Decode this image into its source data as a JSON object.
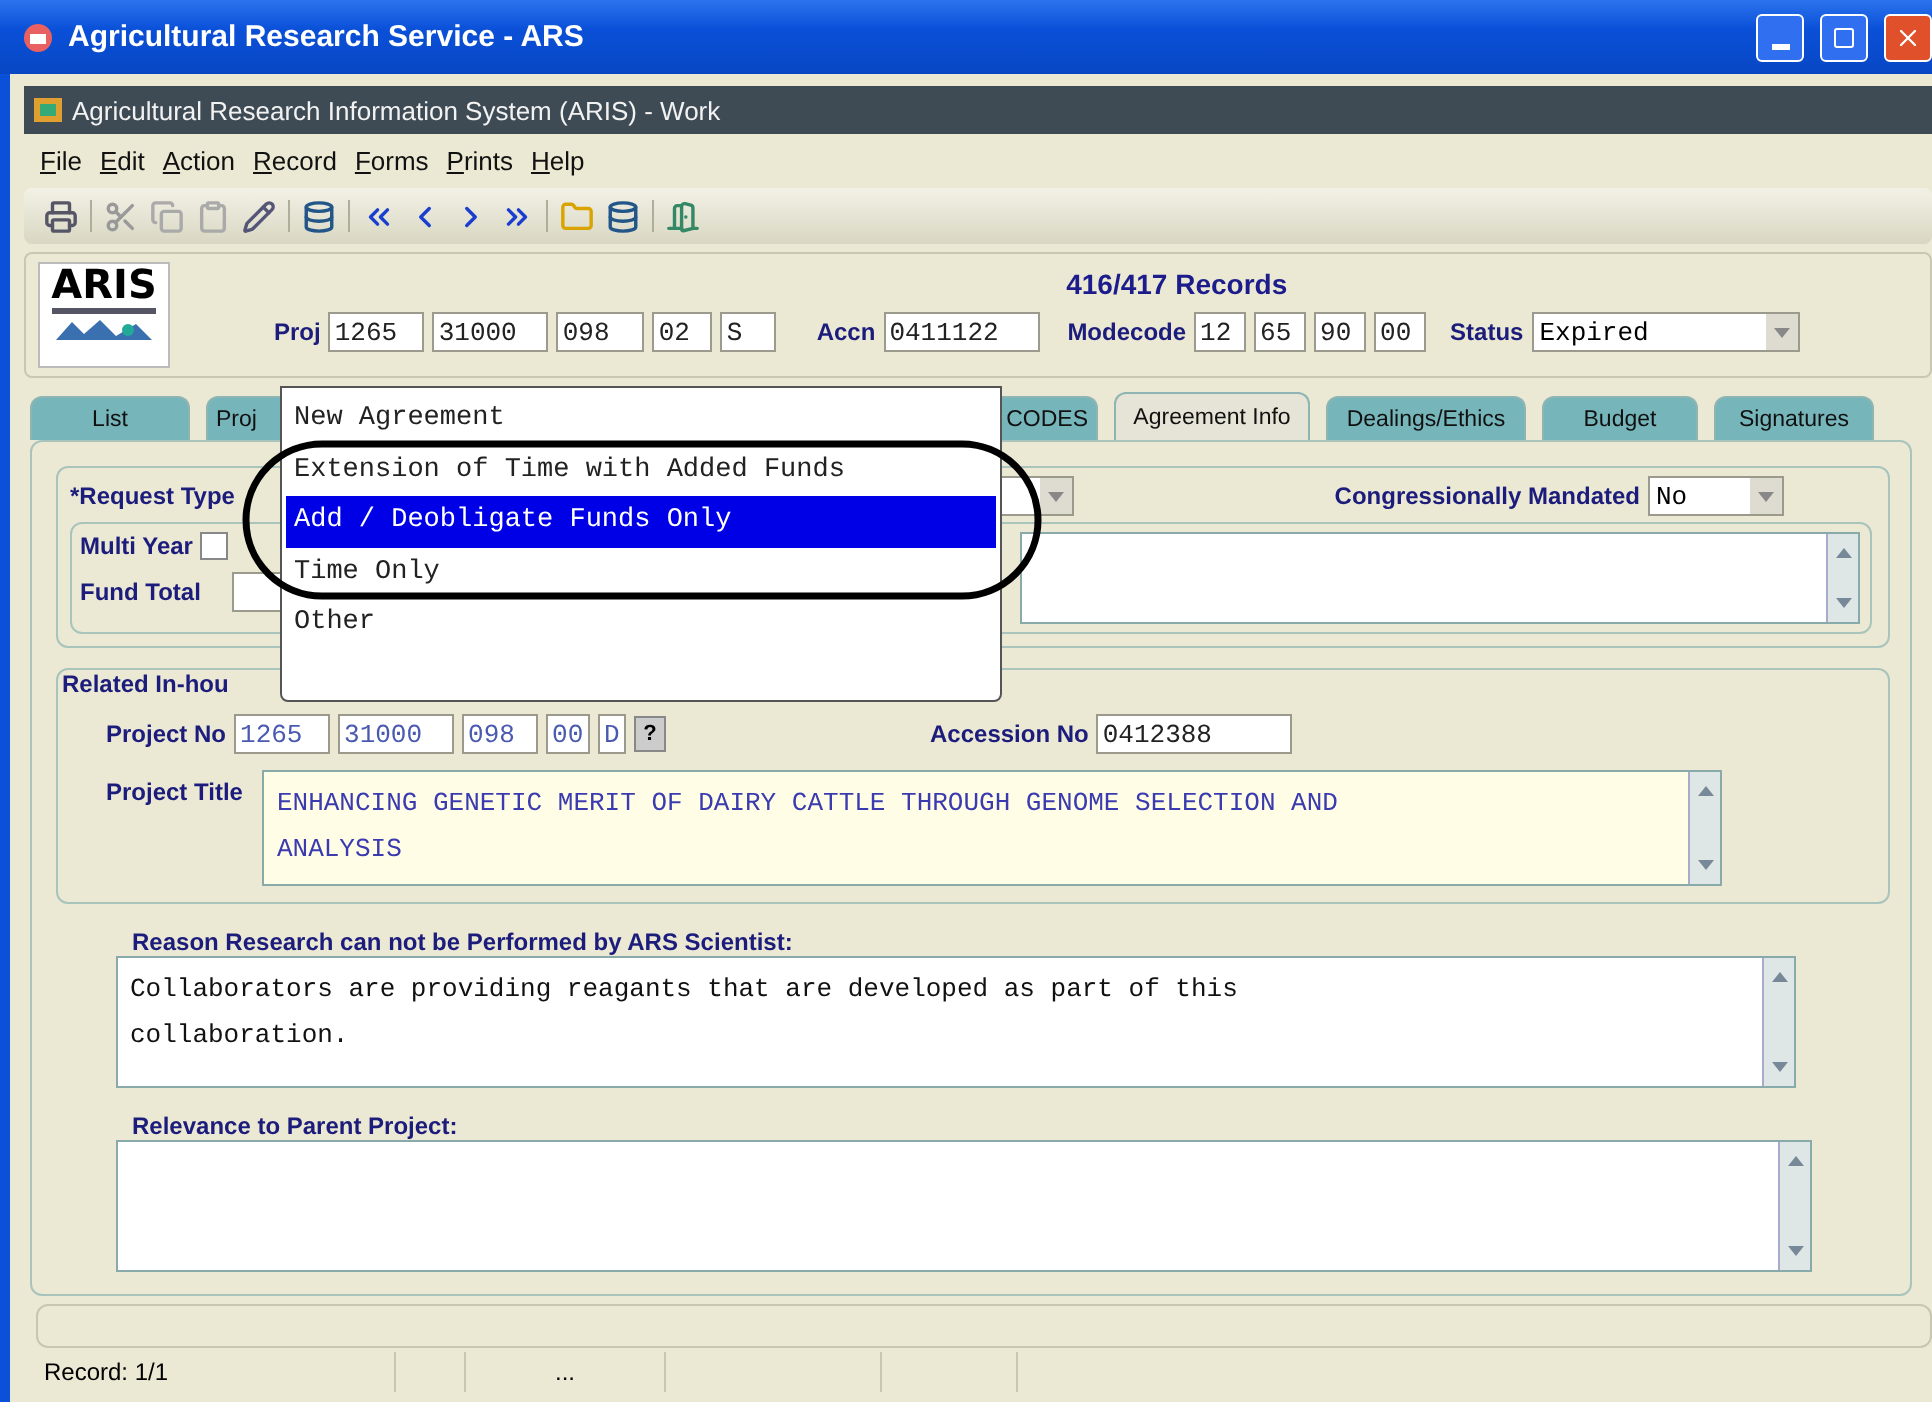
{
  "window": {
    "title": "Agricultural Research Service - ARS"
  },
  "app_title": "Agricultural Research Information System (ARIS) - Work",
  "menu": [
    "File",
    "Edit",
    "Action",
    "Record",
    "Forms",
    "Prints",
    "Help"
  ],
  "header": {
    "logo": "ARIS",
    "records": "416/417 Records",
    "proj_label": "Proj",
    "proj": [
      "1265",
      "31000",
      "098",
      "02",
      "S"
    ],
    "accn_label": "Accn",
    "accn": "0411122",
    "modecode_label": "Modecode",
    "modecode": [
      "12",
      "65",
      "90",
      "00"
    ],
    "status_label": "Status",
    "status": "Expired"
  },
  "tabs": [
    {
      "label": "List",
      "selected": false
    },
    {
      "label": "Proj",
      "selected": false
    },
    {
      "label": "CODES",
      "selected": false
    },
    {
      "label": "Agreement Info",
      "selected": true
    },
    {
      "label": "Dealings/Ethics",
      "selected": false
    },
    {
      "label": "Budget",
      "selected": false
    },
    {
      "label": "Signatures",
      "selected": false
    }
  ],
  "request": {
    "type_label": "*Request Type",
    "mandated_label": "Congressionally Mandated",
    "mandated": "No",
    "multi_year_label": "Multi Year",
    "multi_year_checked": false,
    "fund_total_label": "Fund Total"
  },
  "related": {
    "legend": "Related In-hou",
    "project_no_label": "Project No",
    "project_no": [
      "1265",
      "31000",
      "098",
      "00",
      "D"
    ],
    "help": "?",
    "accession_label": "Accession No",
    "accession": "0412388",
    "title_label": "Project Title",
    "title": "ENHANCING GENETIC MERIT OF DAIRY CATTLE THROUGH GENOME SELECTION AND ANALYSIS"
  },
  "reason": {
    "label": "Reason Research can not be Performed by ARS Scientist:",
    "value": "Collaborators are providing reagants that are developed as part of this collaboration."
  },
  "relevance": {
    "label": "Relevance to Parent Project:"
  },
  "dropdown": {
    "options": [
      {
        "label": "New Agreement",
        "selected": false
      },
      {
        "label": "Extension of Time with Added Funds",
        "selected": false
      },
      {
        "label": "Add / Deobligate Funds Only",
        "selected": true
      },
      {
        "label": "Time Only",
        "selected": false
      },
      {
        "label": "Other",
        "selected": false
      }
    ]
  },
  "status_bar": {
    "record": "Record: 1/1",
    "cell": "..."
  }
}
